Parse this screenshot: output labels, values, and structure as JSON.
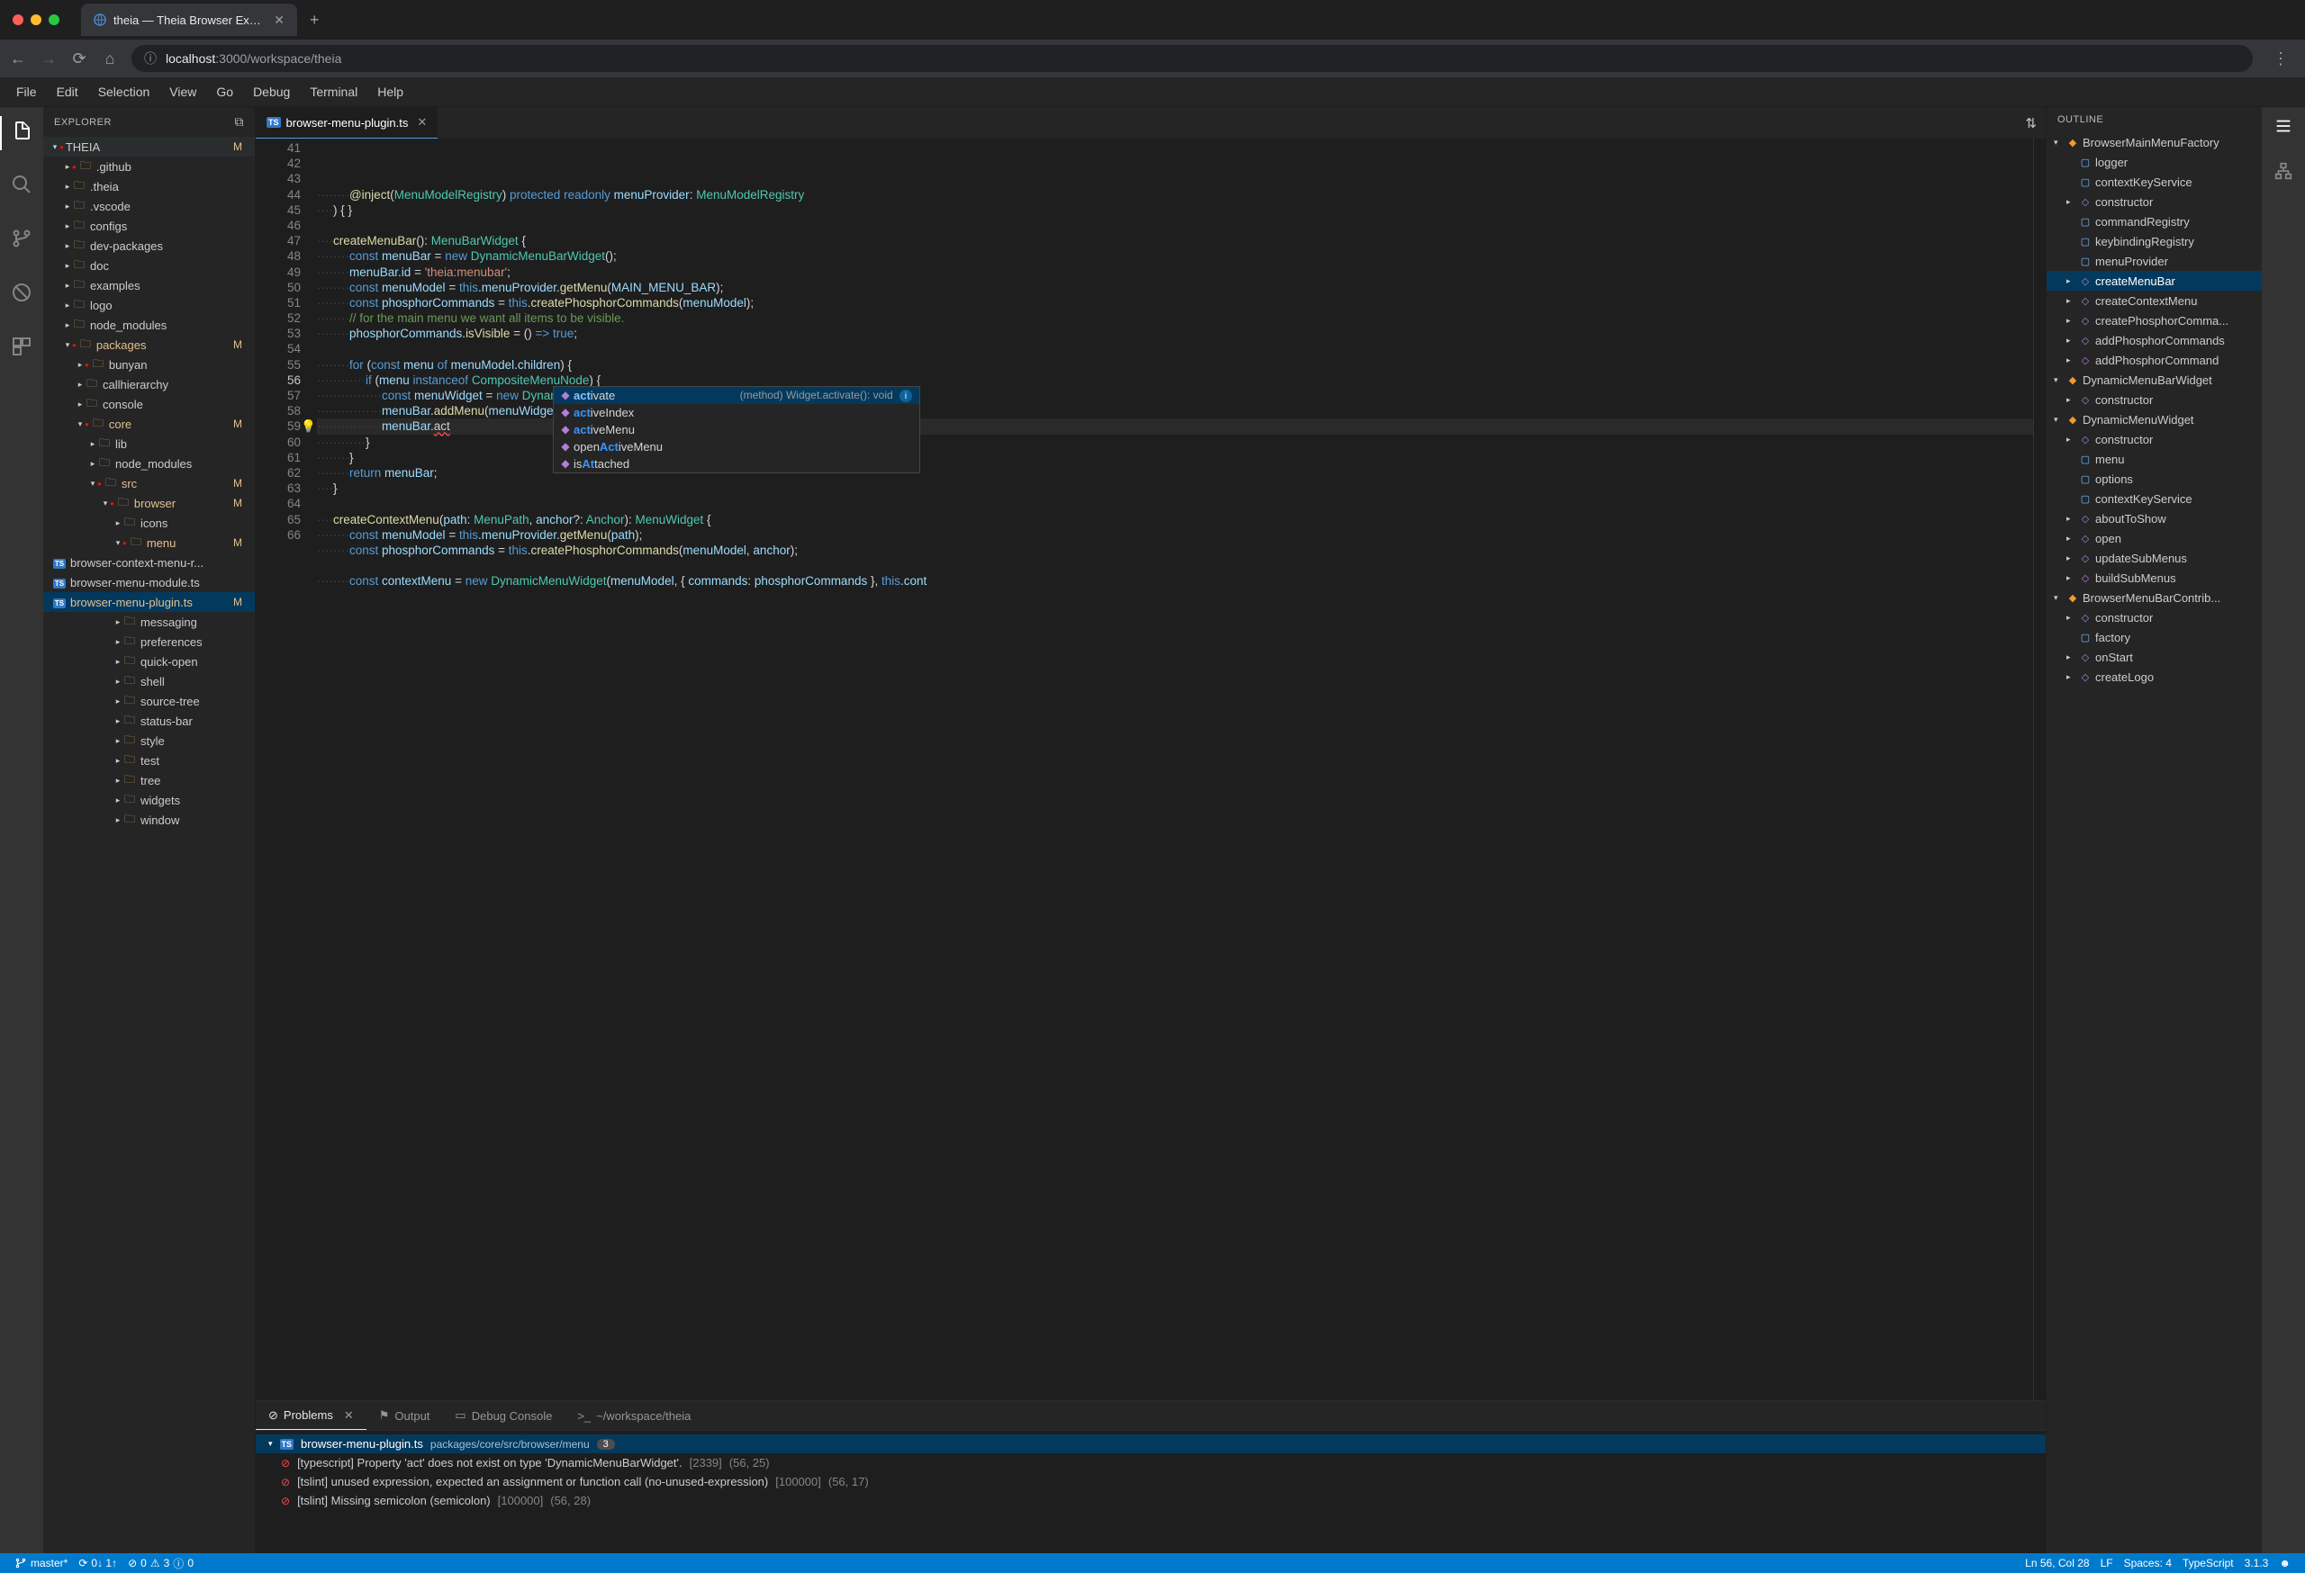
{
  "browser": {
    "tab_title": "theia — Theia Browser Exampl",
    "url_host": "localhost",
    "url_path": ":3000/workspace/theia"
  },
  "menu": [
    "File",
    "Edit",
    "Selection",
    "View",
    "Go",
    "Debug",
    "Terminal",
    "Help"
  ],
  "sidebar": {
    "title": "EXPLORER",
    "root": "THEIA",
    "tree": [
      {
        "name": ".github",
        "type": "folder",
        "depth": 1,
        "expanded": false,
        "git": true
      },
      {
        "name": ".theia",
        "type": "folder",
        "depth": 1,
        "expanded": false
      },
      {
        "name": ".vscode",
        "type": "folder",
        "depth": 1,
        "expanded": false
      },
      {
        "name": "configs",
        "type": "folder",
        "depth": 1,
        "expanded": false
      },
      {
        "name": "dev-packages",
        "type": "folder",
        "depth": 1,
        "expanded": false
      },
      {
        "name": "doc",
        "type": "folder",
        "depth": 1,
        "expanded": false
      },
      {
        "name": "examples",
        "type": "folder",
        "depth": 1,
        "expanded": false
      },
      {
        "name": "logo",
        "type": "folder",
        "depth": 1,
        "expanded": false
      },
      {
        "name": "node_modules",
        "type": "folder",
        "depth": 1,
        "expanded": false
      },
      {
        "name": "packages",
        "type": "folder",
        "depth": 1,
        "expanded": true,
        "mod": true,
        "git": true
      },
      {
        "name": "bunyan",
        "type": "folder",
        "depth": 2,
        "expanded": false,
        "git": true
      },
      {
        "name": "callhierarchy",
        "type": "folder",
        "depth": 2,
        "expanded": false
      },
      {
        "name": "console",
        "type": "folder",
        "depth": 2,
        "expanded": false
      },
      {
        "name": "core",
        "type": "folder",
        "depth": 2,
        "expanded": true,
        "mod": true,
        "git": true
      },
      {
        "name": "lib",
        "type": "folder",
        "depth": 3,
        "expanded": false
      },
      {
        "name": "node_modules",
        "type": "folder",
        "depth": 3,
        "expanded": false
      },
      {
        "name": "src",
        "type": "folder",
        "depth": 3,
        "expanded": true,
        "mod": true,
        "git": true
      },
      {
        "name": "browser",
        "type": "folder",
        "depth": 4,
        "expanded": true,
        "mod": true,
        "git": true
      },
      {
        "name": "icons",
        "type": "folder",
        "depth": 5,
        "expanded": false
      },
      {
        "name": "menu",
        "type": "folder",
        "depth": 5,
        "expanded": true,
        "mod": true,
        "git": true
      },
      {
        "name": "browser-context-menu-r...",
        "type": "file",
        "depth": 6,
        "fileType": "ts"
      },
      {
        "name": "browser-menu-module.ts",
        "type": "file",
        "depth": 6,
        "fileType": "ts"
      },
      {
        "name": "browser-menu-plugin.ts",
        "type": "file",
        "depth": 6,
        "fileType": "ts",
        "mod": true,
        "selected": true
      },
      {
        "name": "messaging",
        "type": "folder",
        "depth": 5,
        "expanded": false
      },
      {
        "name": "preferences",
        "type": "folder",
        "depth": 5,
        "expanded": false
      },
      {
        "name": "quick-open",
        "type": "folder",
        "depth": 5,
        "expanded": false
      },
      {
        "name": "shell",
        "type": "folder",
        "depth": 5,
        "expanded": false
      },
      {
        "name": "source-tree",
        "type": "folder",
        "depth": 5,
        "expanded": false
      },
      {
        "name": "status-bar",
        "type": "folder",
        "depth": 5,
        "expanded": false
      },
      {
        "name": "style",
        "type": "folder",
        "depth": 5,
        "expanded": false
      },
      {
        "name": "test",
        "type": "folder",
        "depth": 5,
        "expanded": false
      },
      {
        "name": "tree",
        "type": "folder",
        "depth": 5,
        "expanded": false
      },
      {
        "name": "widgets",
        "type": "folder",
        "depth": 5,
        "expanded": false
      },
      {
        "name": "window",
        "type": "folder",
        "depth": 5,
        "expanded": false
      }
    ]
  },
  "editor": {
    "tab": "browser-menu-plugin.ts",
    "line_start": 41,
    "lines": [
      {
        "n": 41,
        "html": "<span class='dots'>········</span><span class='tk-fn'>@inject</span>(<span class='tk-type'>MenuModelRegistry</span>) <span class='tk-key'>protected</span> <span class='tk-key'>readonly</span> <span class='tk-var'>menuProvider</span>: <span class='tk-type'>MenuModelRegistry</span>"
      },
      {
        "n": 42,
        "html": "<span class='dots'>····</span>) { }"
      },
      {
        "n": 43,
        "html": ""
      },
      {
        "n": 44,
        "html": "<span class='dots'>····</span><span class='tk-fn'>createMenuBar</span>(): <span class='tk-type'>MenuBarWidget</span> {"
      },
      {
        "n": 45,
        "html": "<span class='dots'>········</span><span class='tk-key'>const</span> <span class='tk-var'>menuBar</span> = <span class='tk-key'>new</span> <span class='tk-type'>DynamicMenuBarWidget</span>();"
      },
      {
        "n": 46,
        "html": "<span class='dots'>········</span><span class='tk-var'>menuBar</span>.<span class='tk-prop'>id</span> = <span class='tk-str'>'theia:menubar'</span>;"
      },
      {
        "n": 47,
        "html": "<span class='dots'>········</span><span class='tk-key'>const</span> <span class='tk-var'>menuModel</span> = <span class='tk-key'>this</span>.<span class='tk-var'>menuProvider</span>.<span class='tk-fn'>getMenu</span>(<span class='tk-var'>MAIN_MENU_BAR</span>);"
      },
      {
        "n": 48,
        "html": "<span class='dots'>········</span><span class='tk-key'>const</span> <span class='tk-var'>phosphorCommands</span> = <span class='tk-key'>this</span>.<span class='tk-fn'>createPhosphorCommands</span>(<span class='tk-var'>menuModel</span>);"
      },
      {
        "n": 49,
        "html": "<span class='dots'>········</span><span class='tk-com'>// for the main menu we want all items to be visible.</span>"
      },
      {
        "n": 50,
        "html": "<span class='dots'>········</span><span class='tk-var'>phosphorCommands</span>.<span class='tk-fn'>isVisible</span> = () <span class='tk-key'>=&gt;</span> <span class='tk-key'>true</span>;"
      },
      {
        "n": 51,
        "html": ""
      },
      {
        "n": 52,
        "html": "<span class='dots'>········</span><span class='tk-key'>for</span> (<span class='tk-key'>const</span> <span class='tk-var'>menu</span> <span class='tk-key'>of</span> <span class='tk-var'>menuModel</span>.<span class='tk-prop'>children</span>) {"
      },
      {
        "n": 53,
        "html": "<span class='dots'>············</span><span class='tk-key'>if</span> (<span class='tk-var'>menu</span> <span class='tk-key'>instanceof</span> <span class='tk-type'>CompositeMenuNode</span>) {"
      },
      {
        "n": 54,
        "html": "<span class='dots'>················</span><span class='tk-key'>const</span> <span class='tk-var'>menuWidget</span> = <span class='tk-key'>new</span> <span class='tk-type'>DynamicMenuWidget</span>(<span class='tk-var'>menu</span>, { <span class='tk-prop'>commands</span>: <span class='tk-var'>phosphorCommands</span> }, <span class='tk-key'>this</span>.<span class='tk-var'>co</span>"
      },
      {
        "n": 55,
        "html": "<span class='dots'>················</span><span class='tk-var'>menuBar</span>.<span class='tk-fn'>addMenu</span>(<span class='tk-var'>menuWidget</span>);"
      },
      {
        "n": 56,
        "html": "<span class='dots'>················</span><span class='tk-var'>menuBar</span>.<span class='error-underline'>act</span>",
        "current": true,
        "bulb": true
      },
      {
        "n": 57,
        "html": "<span class='dots'>············</span>}"
      },
      {
        "n": 58,
        "html": "<span class='dots'>········</span>}"
      },
      {
        "n": 59,
        "html": "<span class='dots'>········</span><span class='tk-key'>return</span> <span class='tk-var'>menuBar</span>;"
      },
      {
        "n": 60,
        "html": "<span class='dots'>····</span>}"
      },
      {
        "n": 61,
        "html": ""
      },
      {
        "n": 62,
        "html": "<span class='dots'>····</span><span class='tk-fn'>createContextMenu</span>(<span class='tk-var'>path</span>: <span class='tk-type'>MenuPath</span>, <span class='tk-var'>anchor</span>?: <span class='tk-type'>Anchor</span>): <span class='tk-type'>MenuWidget</span> {"
      },
      {
        "n": 63,
        "html": "<span class='dots'>········</span><span class='tk-key'>const</span> <span class='tk-var'>menuModel</span> = <span class='tk-key'>this</span>.<span class='tk-var'>menuProvider</span>.<span class='tk-fn'>getMenu</span>(<span class='tk-var'>path</span>);"
      },
      {
        "n": 64,
        "html": "<span class='dots'>········</span><span class='tk-key'>const</span> <span class='tk-var'>phosphorCommands</span> = <span class='tk-key'>this</span>.<span class='tk-fn'>createPhosphorCommands</span>(<span class='tk-var'>menuModel</span>, <span class='tk-var'>anchor</span>);"
      },
      {
        "n": 65,
        "html": ""
      },
      {
        "n": 66,
        "html": "<span class='dots'>········</span><span class='tk-key'>const</span> <span class='tk-var'>contextMenu</span> = <span class='tk-key'>new</span> <span class='tk-type'>DynamicMenuWidget</span>(<span class='tk-var'>menuModel</span>, { <span class='tk-prop'>commands</span>: <span class='tk-var'>phosphorCommands</span> }, <span class='tk-key'>this</span>.<span class='tk-var'>cont</span>"
      }
    ]
  },
  "suggest": {
    "items": [
      {
        "label_pre": "act",
        "label_post": "ivate",
        "kind": "method",
        "selected": true,
        "detail": "(method) Widget.activate(): void"
      },
      {
        "label_pre": "act",
        "label_post": "iveIndex",
        "kind": "method"
      },
      {
        "label_pre": "act",
        "label_post": "iveMenu",
        "kind": "method"
      },
      {
        "label_pre": "",
        "mid": "Act",
        "label_pre2": "open",
        "label_post": "iveMenu",
        "kind": "method"
      },
      {
        "label_pre2": "is",
        "mid": "At",
        "label_post": "tached",
        "kind": "method"
      }
    ]
  },
  "panel": {
    "tabs": [
      {
        "label": "Problems",
        "icon": "⊘",
        "active": true,
        "closable": true
      },
      {
        "label": "Output",
        "icon": "⚑"
      },
      {
        "label": "Debug Console",
        "icon": "▭"
      },
      {
        "label": "~/workspace/theia",
        "icon": ">_"
      }
    ],
    "file": {
      "name": "browser-menu-plugin.ts",
      "path": "packages/core/src/browser/menu",
      "count": "3"
    },
    "problems": [
      {
        "src": "[typescript]",
        "msg": "Property 'act' does not exist on type 'DynamicMenuBarWidget'.",
        "code": "[2339]",
        "loc": "(56, 25)"
      },
      {
        "src": "[tslint]",
        "msg": "unused expression, expected an assignment or function call (no-unused-expression)",
        "code": "[100000]",
        "loc": "(56, 17)"
      },
      {
        "src": "[tslint]",
        "msg": "Missing semicolon (semicolon)",
        "code": "[100000]",
        "loc": "(56, 28)"
      }
    ]
  },
  "outline": {
    "title": "OUTLINE",
    "items": [
      {
        "name": "BrowserMainMenuFactory",
        "kind": "class",
        "depth": 0,
        "expanded": true
      },
      {
        "name": "logger",
        "kind": "field",
        "depth": 1
      },
      {
        "name": "contextKeyService",
        "kind": "field",
        "depth": 1
      },
      {
        "name": "constructor",
        "kind": "method",
        "depth": 1
      },
      {
        "name": "commandRegistry",
        "kind": "field",
        "depth": 1
      },
      {
        "name": "keybindingRegistry",
        "kind": "field",
        "depth": 1
      },
      {
        "name": "menuProvider",
        "kind": "field",
        "depth": 1
      },
      {
        "name": "createMenuBar",
        "kind": "method",
        "depth": 1,
        "selected": true
      },
      {
        "name": "createContextMenu",
        "kind": "method",
        "depth": 1
      },
      {
        "name": "createPhosphorComma...",
        "kind": "method",
        "depth": 1
      },
      {
        "name": "addPhosphorCommands",
        "kind": "method",
        "depth": 1
      },
      {
        "name": "addPhosphorCommand",
        "kind": "method",
        "depth": 1
      },
      {
        "name": "DynamicMenuBarWidget",
        "kind": "class",
        "depth": 0,
        "expanded": true
      },
      {
        "name": "constructor",
        "kind": "method",
        "depth": 1
      },
      {
        "name": "DynamicMenuWidget",
        "kind": "class",
        "depth": 0,
        "expanded": true
      },
      {
        "name": "constructor",
        "kind": "method",
        "depth": 1
      },
      {
        "name": "menu",
        "kind": "field",
        "depth": 1
      },
      {
        "name": "options",
        "kind": "field",
        "depth": 1
      },
      {
        "name": "contextKeyService",
        "kind": "field",
        "depth": 1
      },
      {
        "name": "aboutToShow",
        "kind": "method",
        "depth": 1
      },
      {
        "name": "open",
        "kind": "method",
        "depth": 1
      },
      {
        "name": "updateSubMenus",
        "kind": "method",
        "depth": 1
      },
      {
        "name": "buildSubMenus",
        "kind": "method",
        "depth": 1
      },
      {
        "name": "BrowserMenuBarContrib...",
        "kind": "class",
        "depth": 0,
        "expanded": true
      },
      {
        "name": "constructor",
        "kind": "method",
        "depth": 1
      },
      {
        "name": "factory",
        "kind": "field",
        "depth": 1
      },
      {
        "name": "onStart",
        "kind": "method",
        "depth": 1
      },
      {
        "name": "createLogo",
        "kind": "method",
        "depth": 1
      }
    ]
  },
  "status": {
    "branch": "master*",
    "sync": "0↓ 1↑",
    "errors": "0",
    "warnings": "3",
    "info": "0",
    "line_col": "Ln 56, Col 28",
    "eol": "LF",
    "spaces": "Spaces: 4",
    "lang": "TypeScript",
    "version": "3.1.3"
  }
}
